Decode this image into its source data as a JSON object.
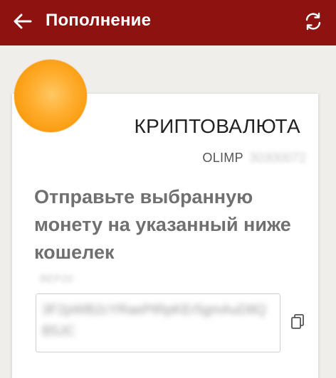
{
  "app_bar": {
    "title": "Пополнение",
    "background_color": "#8e1310",
    "back_icon": "arrow-left-icon",
    "refresh_icon": "refresh-icon"
  },
  "card": {
    "coin_icon": "coin-icon",
    "coin_color": "#f99a0c",
    "heading": "КРИПТОВАЛЮТА",
    "account_label": "OLIMP",
    "account_number": "30300072",
    "instruction": "Отправьте выбранную монету на указанный ниже кошелек",
    "network_label": "BEP20",
    "address": "3F2pWB2cYRaePtRpKEr5gmAuD8QB5JC",
    "copy_icon": "copy-icon"
  }
}
